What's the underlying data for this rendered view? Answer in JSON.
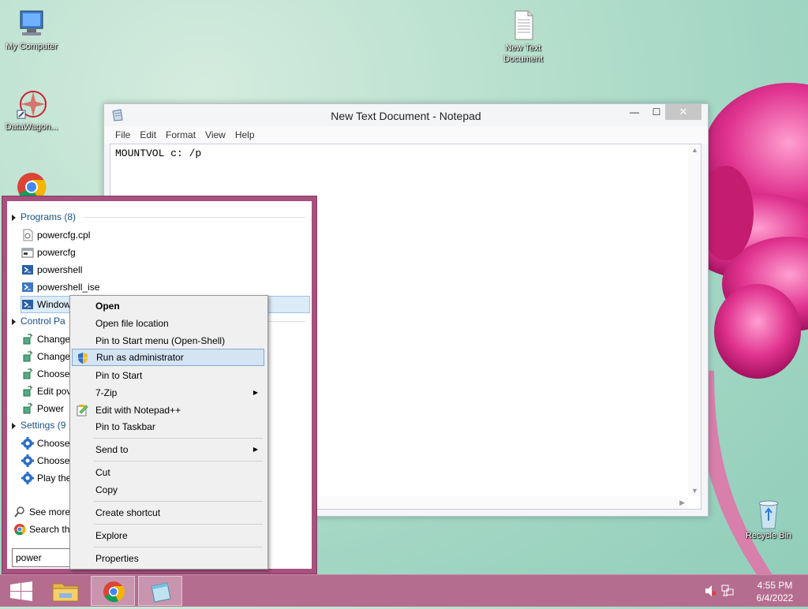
{
  "desktop": {
    "icons": [
      {
        "label": "My Computer"
      },
      {
        "label": "DataWagon..."
      },
      {
        "label": "New Text Document"
      },
      {
        "label": "Recycle Bin"
      }
    ]
  },
  "notepad": {
    "title": "New Text Document - Notepad",
    "controls": {
      "minimize": "—",
      "maximize": "☐",
      "close": "✕"
    },
    "menu": [
      "File",
      "Edit",
      "Format",
      "View",
      "Help"
    ],
    "content": "MOUNTVOL c: /p"
  },
  "start_menu": {
    "programs_header": "Programs (8)",
    "programs": [
      "powercfg.cpl",
      "powercfg",
      "powershell",
      "powershell_ise",
      "Window"
    ],
    "control_panel_header": "Control Pa",
    "control_panel": [
      "Change",
      "Change",
      "Choose",
      "Edit pov",
      "Power"
    ],
    "settings_header": "Settings (9",
    "settings": [
      "Choose",
      "Choose",
      "Play the"
    ],
    "see_more": "See more r",
    "search_the": "Search the",
    "search_value": "power"
  },
  "context_menu": {
    "items": [
      {
        "label": "Open",
        "bold": true
      },
      {
        "label": "Open file location"
      },
      {
        "label": "Pin to Start menu (Open-Shell)"
      },
      {
        "label": "Run as administrator",
        "highlight": true
      },
      {
        "label": "Pin to Start"
      },
      {
        "label": "7-Zip",
        "submenu": true
      },
      {
        "label": "Edit with Notepad++"
      },
      {
        "label": "Pin to Taskbar"
      },
      {
        "label": "Send to",
        "submenu": true
      },
      {
        "label": "Cut"
      },
      {
        "label": "Copy"
      },
      {
        "label": "Create shortcut"
      },
      {
        "label": "Explore"
      },
      {
        "label": "Properties"
      }
    ]
  },
  "taskbar": {
    "time": "4:55 PM",
    "date": "6/4/2022"
  },
  "colors": {
    "taskbar": "#b56d8f",
    "start_menu_border": "#a8507e",
    "highlight": "#d5e4f3"
  }
}
